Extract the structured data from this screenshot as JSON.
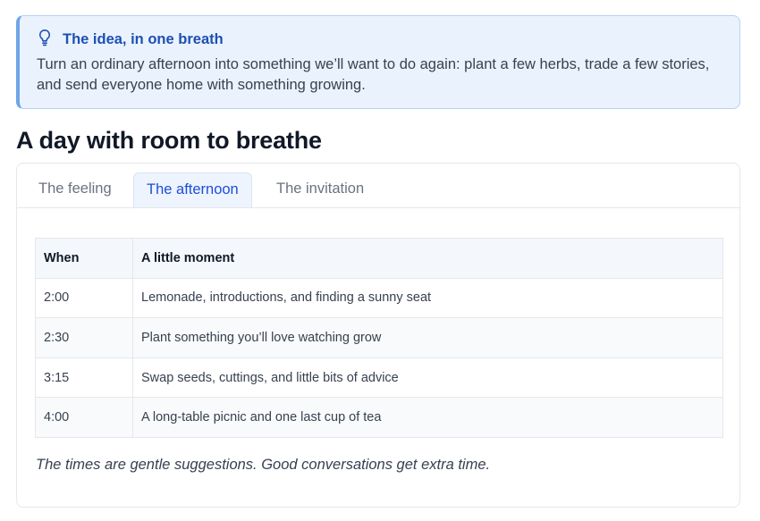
{
  "callout": {
    "icon": "lightbulb-icon",
    "title": "The idea, in one breath",
    "body": "Turn an ordinary afternoon into something we’ll want to do again: plant a few herbs, trade a few stories, and send everyone home with something growing."
  },
  "section": {
    "title": "A day with room to breathe"
  },
  "tabs": [
    {
      "label": "The feeling",
      "active": false
    },
    {
      "label": "The afternoon",
      "active": true
    },
    {
      "label": "The invitation",
      "active": false
    }
  ],
  "schedule": {
    "headers": [
      "When",
      "A little moment"
    ],
    "rows": [
      {
        "when": "2:00",
        "moment": "Lemonade, introductions, and finding a sunny seat"
      },
      {
        "when": "2:30",
        "moment": "Plant something you’ll love watching grow"
      },
      {
        "when": "3:15",
        "moment": "Swap seeds, cuttings, and little bits of advice"
      },
      {
        "when": "4:00",
        "moment": "A long-table picnic and one last cup of tea"
      }
    ],
    "note": "The times are gentle suggestions. Good conversations get extra time."
  },
  "colors": {
    "accent": "#1d4ed8",
    "callout_bg": "#eaf3fd",
    "callout_border": "#6fa6e6"
  }
}
